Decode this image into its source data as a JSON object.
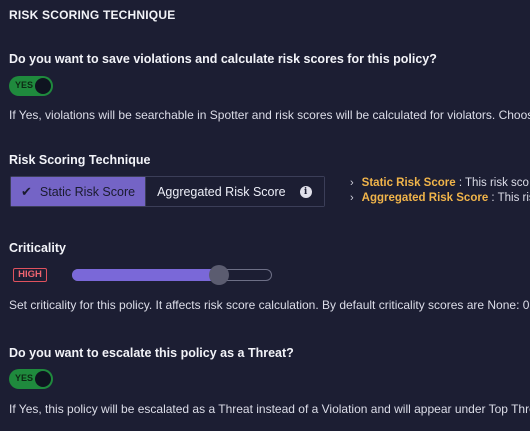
{
  "section_title": "RISK SCORING TECHNIQUE",
  "save_violations": {
    "question": "Do you want to save violations and calculate risk scores for this policy?",
    "toggle_label": "YES",
    "description": "If Yes, violations will be searchable in Spotter and risk scores will be calculated for violators. Choos"
  },
  "risk_technique": {
    "label": "Risk Scoring Technique",
    "options": [
      "Static Risk Score",
      "Aggregated Risk Score"
    ],
    "selected": "Static Risk Score",
    "legend": [
      {
        "key": "Static Risk Score",
        "text": "  : This risk sco"
      },
      {
        "key": "Aggregated Risk Score",
        "text": " : This ris"
      }
    ]
  },
  "criticality": {
    "label": "Criticality",
    "badge": "HIGH",
    "level": 0.76,
    "description": "Set criticality for this policy. It affects risk score calculation. By default criticality scores are None: 0"
  },
  "escalate": {
    "question": "Do you want to escalate this policy as a Threat?",
    "toggle_label": "YES",
    "description": "If Yes, this policy will be escalated as a Threat instead of a Violation and will appear under Top Thre"
  },
  "colors": {
    "background": "#1c1e33",
    "accent": "#7464c6",
    "toggle_on": "#1f8a3d",
    "legend_key": "#f0b44a",
    "badge_high": "#e0525e"
  }
}
